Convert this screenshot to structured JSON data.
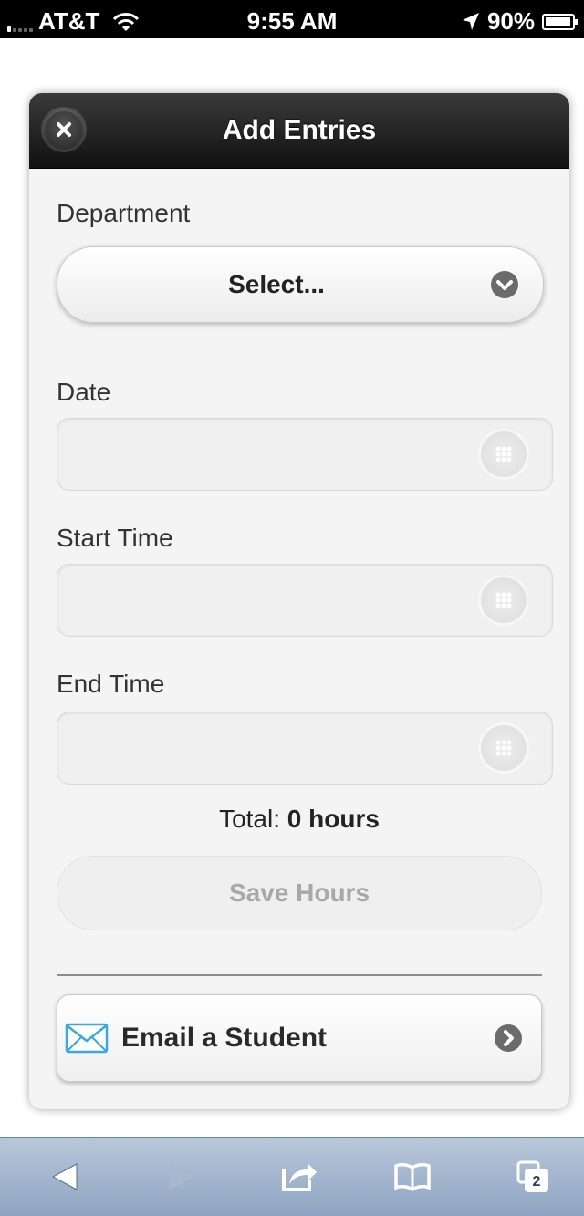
{
  "status_bar": {
    "carrier": "AT&T",
    "time": "9:55 AM",
    "battery": "90%",
    "icons": [
      "signal-icon",
      "wifi-icon",
      "location-icon",
      "battery-icon"
    ]
  },
  "dialog": {
    "title": "Add Entries",
    "close_icon": "close-icon",
    "department": {
      "label": "Department",
      "selected": "Select..."
    },
    "date": {
      "label": "Date",
      "value": ""
    },
    "start_time": {
      "label": "Start Time",
      "value": ""
    },
    "end_time": {
      "label": "End Time",
      "value": ""
    },
    "total": {
      "label": "Total:",
      "value": "0 hours"
    },
    "save_label": "Save Hours",
    "email_label": "Email a Student"
  },
  "browser_toolbar": {
    "tabs_count": "2",
    "buttons": [
      "back-icon",
      "forward-icon",
      "share-icon",
      "bookmarks-icon",
      "tabs-icon"
    ]
  },
  "colors": {
    "header_dark": "#1a1a1a",
    "dialog_bg": "#f4f4f4",
    "disabled_text": "#a8a8a8",
    "toolbar_blue": "#a3b4cc",
    "envelope_blue": "#3ba7e0"
  }
}
